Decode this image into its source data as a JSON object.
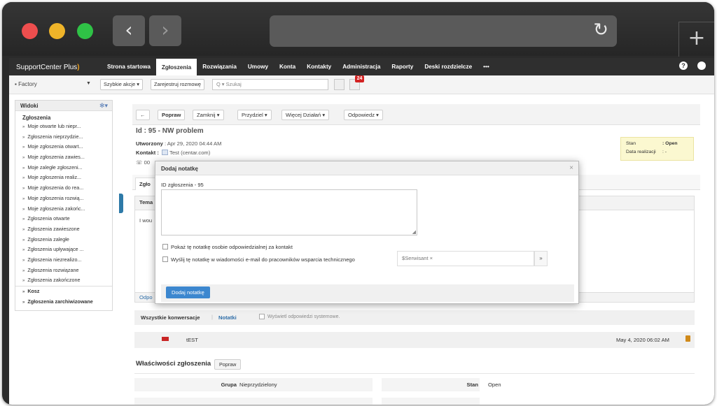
{
  "browser": {
    "back_glyph": "‹",
    "fwd_glyph": "›",
    "reload_glyph": "↻",
    "newtab_glyph": "+"
  },
  "app": {
    "logo": "SupportCenter Plus",
    "nav": [
      "Strona startowa",
      "Zgłoszenia",
      "Rozwiązania",
      "Umowy",
      "Konta",
      "Kontakty",
      "Administracja",
      "Raporty",
      "Deski rozdzielcze",
      "•••"
    ],
    "active_nav_index": 1,
    "help_glyph": "?"
  },
  "toolbar": {
    "factory": "Factory",
    "quick_actions": "Szybkie akcje ▾",
    "log_call": "Zarejestruj rozmowę",
    "search_placeholder": "Q ▾ Szukaj",
    "badge": "24"
  },
  "sidebar": {
    "header": "Widoki",
    "title": "Zgłoszenia",
    "items": [
      "Moje otwarte lub niepr...",
      "Zgłoszenia nieprzydzie...",
      "Moje zgłoszenia otwart...",
      "Moje zgłoszenia zawies...",
      "Moje zaległe zgłoszeni...",
      "Moje zgłoszenia realiz...",
      "Moje zgłoszenia do rea...",
      "Moje zgłoszenia rozwią...",
      "Moje zgłoszenia zakońc...",
      "Zgłoszenia otwarte",
      "Zgłoszenia zawieszone",
      "Zgłoszenia zaległe",
      "Zgłoszenia upływające ...",
      "Zgłoszenia niezrealizo...",
      "Zgłoszenia rozwiązane",
      "Zgłoszenia zakończone"
    ],
    "trash": "Kosz",
    "archived": "Zgłoszenia zarchiwizowane"
  },
  "actions": {
    "back": "←",
    "edit": "Popraw",
    "close": "Zamknij ▾",
    "assign": "Przydziel ▾",
    "more": "Więcej Działań ▾",
    "reply": "Odpowiedz ▾"
  },
  "request": {
    "title": "Id : 95 - NW problem",
    "created_label": "Utworzony",
    "created_value": ": Apr 29, 2020 04:44 AM",
    "contact_label": "Kontakt :",
    "contact_value": "Test (centar.com)",
    "phone_fragment": "00",
    "status_label": "Stan",
    "status_value": ": Open",
    "due_label": "Data realizacji",
    "due_value": ": -",
    "tab_fragment": "Zgło",
    "content_head_fragment": "Tema",
    "content_body_fragment": "I wou",
    "content_foot_fragment": "Odpo"
  },
  "conversations": {
    "all": "Wszystkie konwersacje",
    "separator": "|",
    "notes": "Notatki",
    "system_replies": "Wyświetl odpowiedzi systemowe."
  },
  "note": {
    "text": "tEST",
    "date": "May 4, 2020 06:02 AM"
  },
  "properties": {
    "title": "Właściwości zgłoszenia",
    "edit": "Popraw",
    "group_label": "Grupa",
    "group_value": "Nieprzydzielony",
    "status_label": "Stan",
    "status_value": "Open"
  },
  "modal": {
    "title": "Dodaj notatkę",
    "close_glyph": "×",
    "id_label": "ID zgłoszenia - 95",
    "textarea_value": "",
    "show_to_owner": "Pokaż tę notatkę osobie odpowiedzialnej za kontakt",
    "email_to_techs": "Wyślij tę notatkę w wiadomości e-mail do pracowników wsparcia technicznego",
    "tag": "$Serwisant ×",
    "dropdown_glyph": "»",
    "submit": "Dodaj notatkę"
  }
}
